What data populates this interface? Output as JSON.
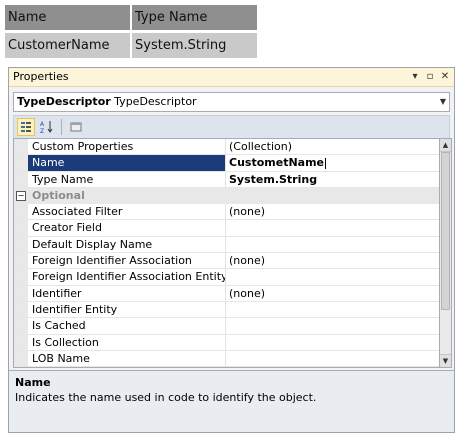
{
  "type_table": {
    "headers": [
      "Name",
      "Type Name"
    ],
    "row": [
      "CustomerName",
      "System.String"
    ]
  },
  "window": {
    "title": "Properties",
    "controls": [
      "dropdown-arrow",
      "maximize",
      "close"
    ],
    "selector": {
      "bold": "TypeDescriptor",
      "rest": "TypeDescriptor"
    }
  },
  "toolbar": {
    "buttons": [
      "categorized-icon",
      "alphabetical-icon",
      "property-pages-icon"
    ]
  },
  "grid": {
    "rows": [
      {
        "name": "Custom Properties",
        "value": "(Collection)"
      },
      {
        "name": "Name",
        "value": "CustometName"
      },
      {
        "name": "Type Name",
        "value": "System.String"
      },
      {
        "category": "Optional"
      },
      {
        "name": "Associated Filter",
        "value": "(none)"
      },
      {
        "name": "Creator Field",
        "value": ""
      },
      {
        "name": "Default Display Name",
        "value": ""
      },
      {
        "name": "Foreign Identifier Association",
        "value": "(none)"
      },
      {
        "name": "Foreign Identifier Association Entity",
        "value": ""
      },
      {
        "name": "Identifier",
        "value": "(none)"
      },
      {
        "name": "Identifier Entity",
        "value": ""
      },
      {
        "name": "Is Cached",
        "value": ""
      },
      {
        "name": "Is Collection",
        "value": ""
      },
      {
        "name": "LOB Name",
        "value": ""
      }
    ]
  },
  "description": {
    "title": "Name",
    "text": "Indicates the name used in code to identify the object."
  }
}
